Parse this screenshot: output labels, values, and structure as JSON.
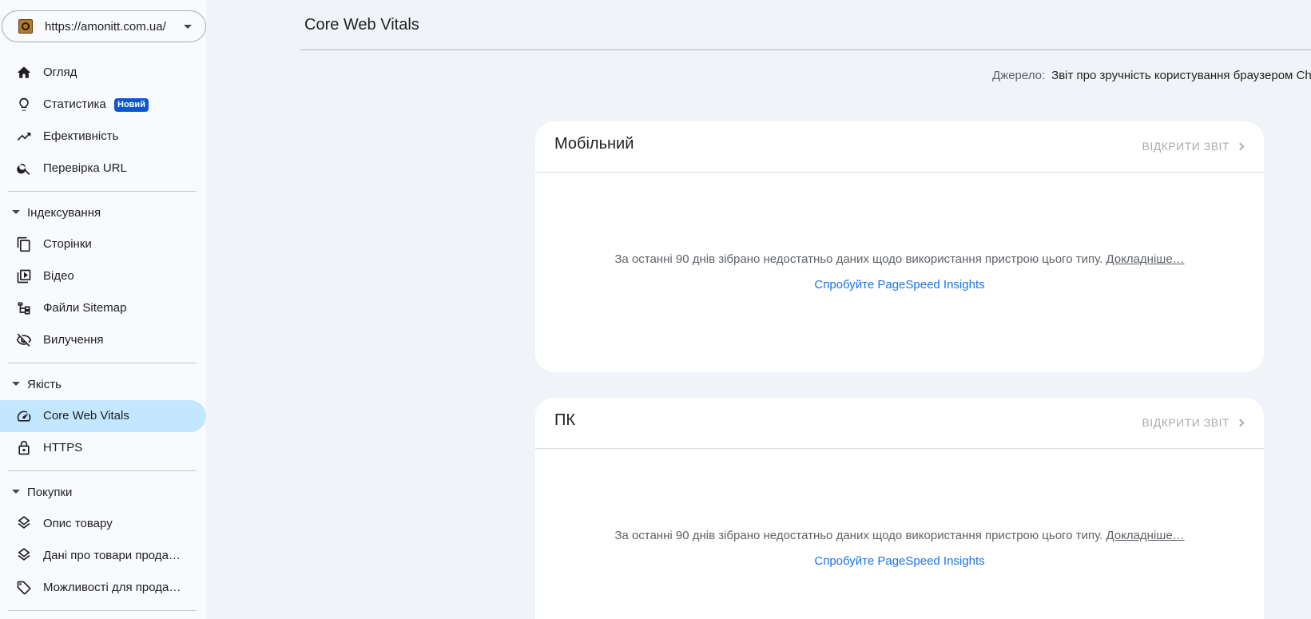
{
  "property": {
    "url": "https://amonitt.com.ua/",
    "favicon": "site-favicon"
  },
  "nav": {
    "overview": "Огляд",
    "insights": "Статистика",
    "insights_badge": "Новий",
    "performance": "Ефективність",
    "url_inspection": "Перевірка URL",
    "indexing_section": "Індексування",
    "pages": "Сторінки",
    "video": "Відео",
    "sitemaps": "Файли Sitemap",
    "removals": "Вилучення",
    "quality_section": "Якість",
    "core_web_vitals": "Core Web Vitals",
    "https": "HTTPS",
    "shopping_section": "Покупки",
    "product_snippets": "Опис товару",
    "merchant_listings": "Дані про товари прода…",
    "shopping_tab": "Можливості для прода…"
  },
  "page": {
    "title": "Core Web Vitals",
    "source_label": "Джерело:",
    "source_value": "Звіт про зручність користування браузером Ch"
  },
  "cards": {
    "mobile": {
      "title": "Мобільний",
      "open_report": "ВІДКРИТИ ЗВІТ",
      "message": "За останні 90 днів зібрано недостатньо даних щодо використання пристрою цього типу.",
      "learn_more": "Докладніше…",
      "pagespeed": "Спробуйте PageSpeed Insights"
    },
    "desktop": {
      "title": "ПК",
      "open_report": "ВІДКРИТИ ЗВІТ",
      "message": "За останні 90 днів зібрано недостатньо даних щодо використання пристрою цього типу.",
      "learn_more": "Докладніше…",
      "pagespeed": "Спробуйте PageSpeed Insights"
    }
  },
  "colors": {
    "active_nav": "#c2e7ff",
    "badge": "#0b57d0",
    "link": "#1a73e8",
    "background": "#f0f4f9"
  }
}
